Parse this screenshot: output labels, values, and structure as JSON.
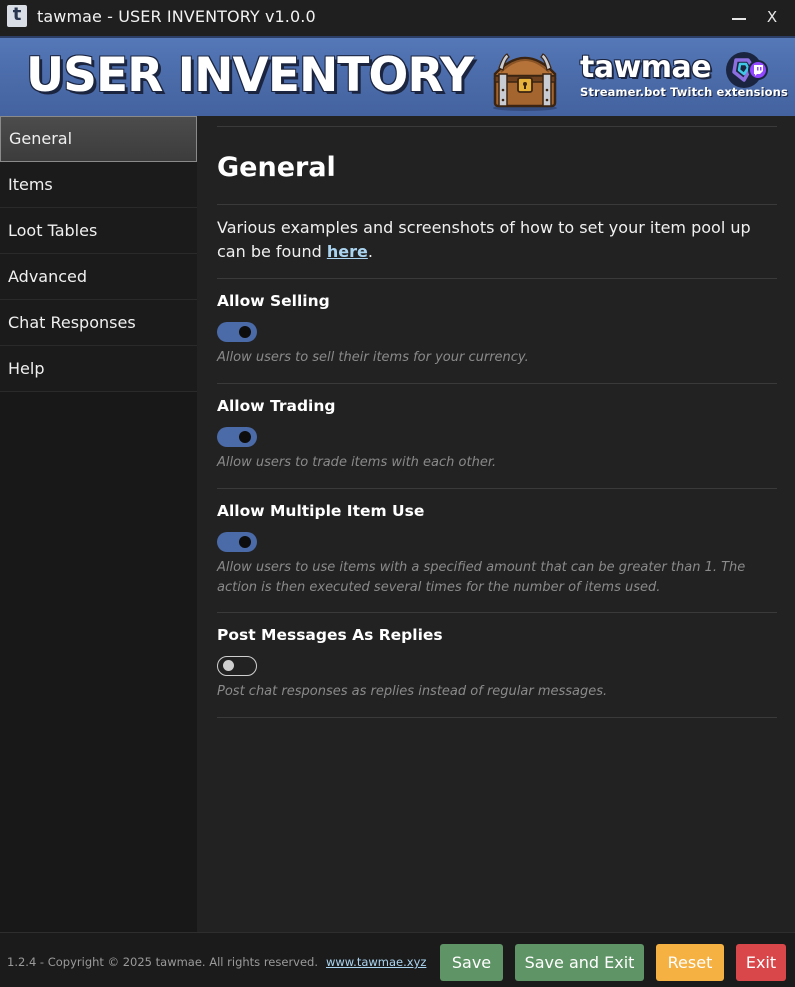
{
  "window": {
    "title": "tawmae - USER INVENTORY v1.0.0",
    "app_icon_letter": "t",
    "minimize_icon": "minimize-icon",
    "close_label": "X"
  },
  "banner": {
    "title": "USER INVENTORY",
    "brand_name": "tawmae",
    "brand_subtitle": "Streamer.bot Twitch extensions",
    "colors": {
      "background": "#4a6aa8",
      "outline": "#1b2540"
    }
  },
  "sidebar": {
    "items": [
      {
        "label": "General",
        "active": true
      },
      {
        "label": "Items",
        "active": false
      },
      {
        "label": "Loot Tables",
        "active": false
      },
      {
        "label": "Advanced",
        "active": false
      },
      {
        "label": "Chat Responses",
        "active": false
      },
      {
        "label": "Help",
        "active": false
      }
    ]
  },
  "main": {
    "title": "General",
    "intro_text": "Various examples and screenshots of how to set your item pool up can be found ",
    "intro_link": "here",
    "intro_end": ".",
    "settings": [
      {
        "label": "Allow Selling",
        "enabled": true,
        "description": "Allow users to sell their items for your currency."
      },
      {
        "label": "Allow Trading",
        "enabled": true,
        "description": "Allow users to trade items with each other."
      },
      {
        "label": "Allow Multiple Item Use",
        "enabled": true,
        "description": "Allow users to use items with a specified amount that can be greater than 1. The action is then executed several times for the number of items used."
      },
      {
        "label": "Post Messages As Replies",
        "enabled": false,
        "description": "Post chat responses as replies instead of regular messages."
      }
    ]
  },
  "footer": {
    "copyright": "1.2.4 - Copyright © 2025 tawmae. All rights reserved.",
    "link": "www.tawmae.xyz",
    "buttons": {
      "save": "Save",
      "save_exit": "Save and Exit",
      "reset": "Reset",
      "exit": "Exit"
    },
    "colors": {
      "save": "#5f9466",
      "reset": "#f6b143",
      "exit": "#d9474a"
    }
  }
}
